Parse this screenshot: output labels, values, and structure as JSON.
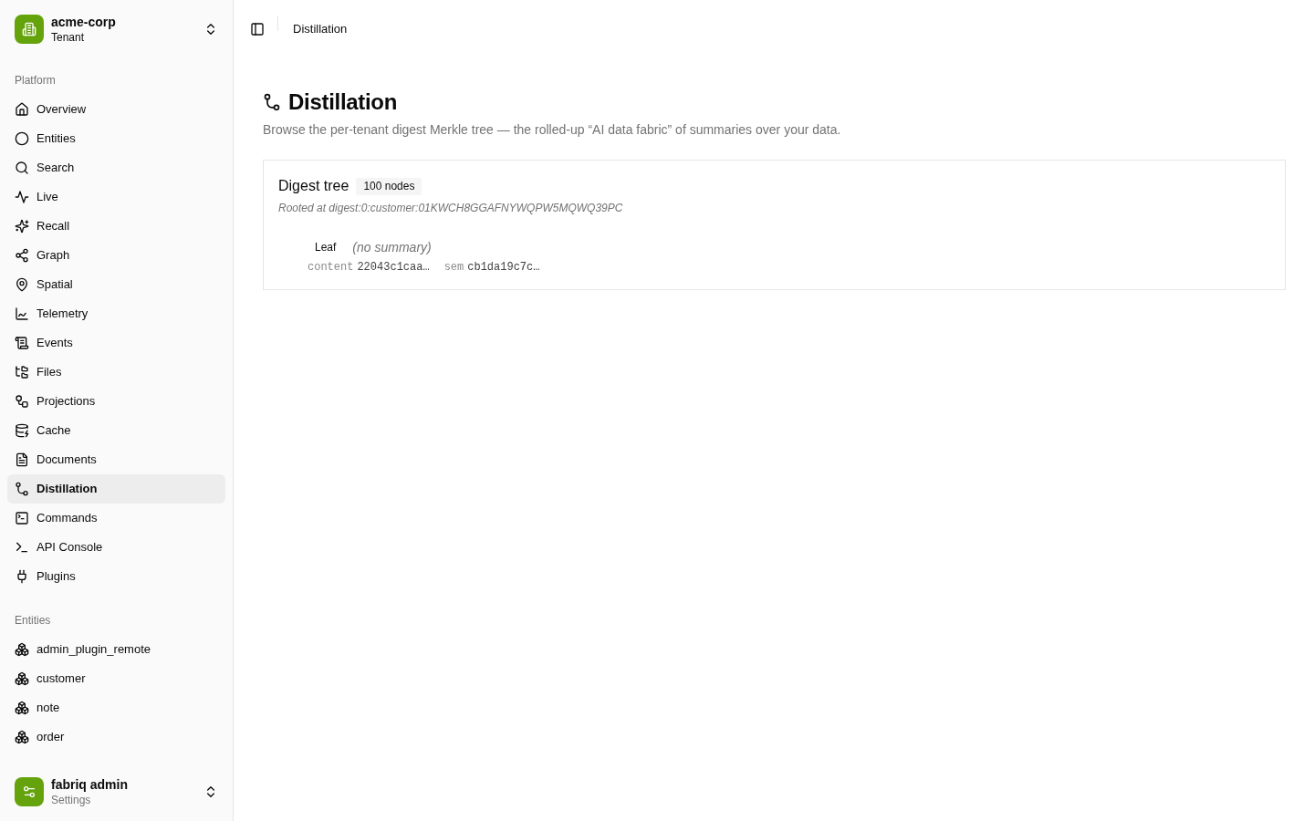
{
  "sidebar": {
    "tenant": {
      "name": "acme-corp",
      "subtitle": "Tenant"
    },
    "groups": [
      {
        "label": "Platform",
        "items": [
          {
            "label": "Overview",
            "selected": false
          },
          {
            "label": "Entities",
            "selected": false
          },
          {
            "label": "Search",
            "selected": false
          },
          {
            "label": "Live",
            "selected": false
          },
          {
            "label": "Recall",
            "selected": false
          },
          {
            "label": "Graph",
            "selected": false
          },
          {
            "label": "Spatial",
            "selected": false
          },
          {
            "label": "Telemetry",
            "selected": false
          },
          {
            "label": "Events",
            "selected": false
          },
          {
            "label": "Files",
            "selected": false
          },
          {
            "label": "Projections",
            "selected": false
          },
          {
            "label": "Cache",
            "selected": false
          },
          {
            "label": "Documents",
            "selected": false
          },
          {
            "label": "Distillation",
            "selected": true
          },
          {
            "label": "Commands",
            "selected": false
          },
          {
            "label": "API Console",
            "selected": false
          },
          {
            "label": "Plugins",
            "selected": false
          }
        ]
      },
      {
        "label": "Entities",
        "items": [
          {
            "label": "admin_plugin_remote",
            "selected": false
          },
          {
            "label": "customer",
            "selected": false
          },
          {
            "label": "note",
            "selected": false
          },
          {
            "label": "order",
            "selected": false
          }
        ]
      }
    ],
    "user": {
      "name": "fabriq admin",
      "subtitle": "Settings"
    }
  },
  "header": {
    "breadcrumb": "Distillation"
  },
  "page": {
    "title": "Distillation",
    "description": "Browse the per-tenant digest Merkle tree — the rolled-up “AI data fabric” of summaries over your data."
  },
  "digest_card": {
    "title": "Digest tree",
    "badge": "100 nodes",
    "root": "Rooted at digest:0:customer:01KWCH8GGAFNYWQPW5MQWQ39PC",
    "nodes": [
      {
        "kind": "leaf",
        "label": "Leaf",
        "summary": "(no summary)",
        "hashes": [
          {
            "label": "content",
            "value": "22043c1caa…"
          },
          {
            "label": "sem",
            "value": "cb1da19c7c…"
          }
        ]
      }
    ]
  }
}
